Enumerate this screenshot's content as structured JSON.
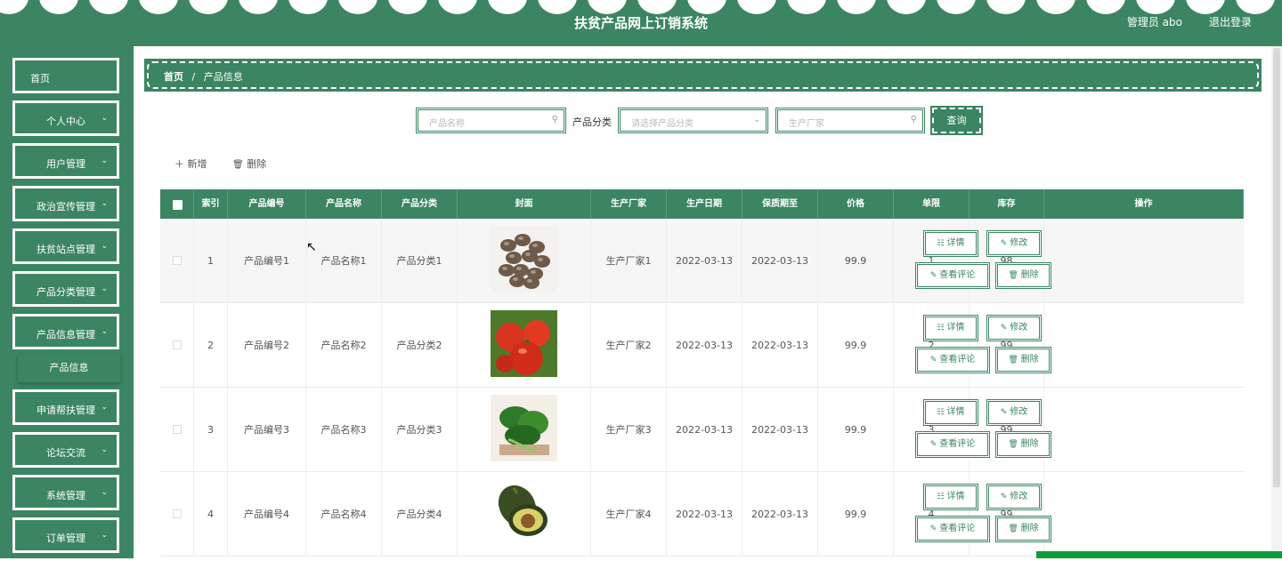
{
  "header": {
    "title": "扶贫产品网上订销系统",
    "admin_label": "管理员 abo",
    "logout_label": "退出登录"
  },
  "sidebar": {
    "items": [
      {
        "label": "首页",
        "has_chevron": false
      },
      {
        "label": "个人中心",
        "has_chevron": true
      },
      {
        "label": "用户管理",
        "has_chevron": true
      },
      {
        "label": "政治宣传管理",
        "has_chevron": true
      },
      {
        "label": "扶贫站点管理",
        "has_chevron": true
      },
      {
        "label": "产品分类管理",
        "has_chevron": true
      },
      {
        "label": "产品信息管理",
        "has_chevron": true
      },
      {
        "label": "申请帮扶管理",
        "has_chevron": true
      },
      {
        "label": "论坛交流",
        "has_chevron": true
      },
      {
        "label": "系统管理",
        "has_chevron": true
      },
      {
        "label": "订单管理",
        "has_chevron": true
      }
    ],
    "submenu_label": "产品信息"
  },
  "breadcrumb": {
    "home": "首页",
    "separator": "/",
    "current": "产品信息"
  },
  "search": {
    "name_placeholder": "产品名称",
    "category_label": "产品分类",
    "category_placeholder": "请选择产品分类",
    "maker_placeholder": "生产厂家",
    "button": "查询"
  },
  "toolbar": {
    "add": "＋ 新增",
    "delete": "删除"
  },
  "table": {
    "headers": [
      "",
      "索引",
      "产品编号",
      "产品名称",
      "产品分类",
      "封面",
      "生产厂家",
      "生产日期",
      "保质期至",
      "价格",
      "单限",
      "库存",
      "操作"
    ],
    "rows": [
      {
        "index": "1",
        "code": "产品编号1",
        "name": "产品名称1",
        "category": "产品分类1",
        "cover": "mushroom",
        "maker": "生产厂家1",
        "prod_date": "2022-03-13",
        "expiry": "2022-03-13",
        "price": "99.9",
        "limit": "1",
        "stock": "98"
      },
      {
        "index": "2",
        "code": "产品编号2",
        "name": "产品名称2",
        "category": "产品分类2",
        "cover": "tomato",
        "maker": "生产厂家2",
        "prod_date": "2022-03-13",
        "expiry": "2022-03-13",
        "price": "99.9",
        "limit": "2",
        "stock": "99"
      },
      {
        "index": "3",
        "code": "产品编号3",
        "name": "产品名称3",
        "category": "产品分类3",
        "cover": "greens",
        "maker": "生产厂家3",
        "prod_date": "2022-03-13",
        "expiry": "2022-03-13",
        "price": "99.9",
        "limit": "3",
        "stock": "99"
      },
      {
        "index": "4",
        "code": "产品编号4",
        "name": "产品名称4",
        "category": "产品分类4",
        "cover": "avocado",
        "maker": "生产厂家4",
        "prod_date": "2022-03-13",
        "expiry": "2022-03-13",
        "price": "99.9",
        "limit": "4",
        "stock": "99"
      }
    ],
    "actions": {
      "detail": "详情",
      "edit": "修改",
      "comments": "查看评论",
      "delete": "删除"
    }
  },
  "colors": {
    "accent": "#3b8562",
    "progress": "#0a9b3a"
  }
}
